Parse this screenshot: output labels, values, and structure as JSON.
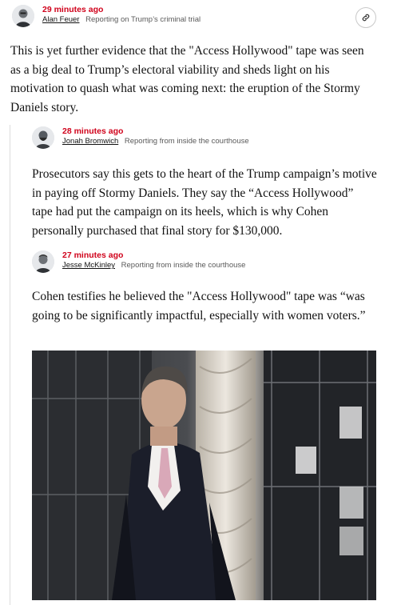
{
  "posts": [
    {
      "time": "29 minutes ago",
      "author": "Alan Feuer",
      "role": "Reporting on Trump’s criminal trial",
      "text": "This is yet further evidence that the \"Access Hollywood\" tape was seen as a big deal to Trump’s electoral viability and sheds light on his motivation to quash what was coming next: the eruption of the Stormy Daniels story."
    },
    {
      "time": "28 minutes ago",
      "author": "Jonah Bromwich",
      "role": "Reporting from inside the courthouse",
      "text": "Prosecutors say this gets to the heart of the Trump campaign’s motive in paying off Stormy Daniels. They say the “Access Hollywood” tape had put the campaign on its heels, which is why Cohen personally purchased that final story for $130,000."
    },
    {
      "time": "27 minutes ago",
      "author": "Jesse McKinley",
      "role": "Reporting from inside the courthouse",
      "text": "Cohen testifies he believed the \"Access Hollywood\" tape was “was going to be significantly impactful, especially with women voters.”"
    }
  ],
  "icons": {
    "share": "link-icon"
  },
  "colors": {
    "timestamp": "#d0021b",
    "text": "#121212",
    "meta": "#5a5a5a"
  }
}
